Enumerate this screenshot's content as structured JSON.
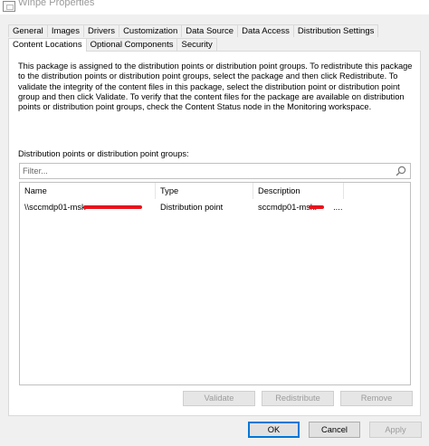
{
  "window": {
    "title": "Winpe Properties"
  },
  "tabs_row1": [
    "General",
    "Images",
    "Drivers",
    "Customization",
    "Data Source",
    "Data Access",
    "Distribution Settings"
  ],
  "tabs_row2": [
    "Content Locations",
    "Optional Components",
    "Security"
  ],
  "active_tab": "Content Locations",
  "description": "This package is assigned to the distribution points or distribution point groups. To redistribute this package to the distribution points or distribution point groups, select the package and then click Redistribute. To validate the integrity of the content files in this package, select the distribution point or distribution point group and then click Validate. To verify that the content files for the package are available on distribution points or distribution point groups, check the Content Status node in the Monitoring workspace.",
  "list": {
    "label": "Distribution points or distribution point groups:",
    "filter_placeholder": "Filter...",
    "columns": [
      "Name",
      "Type",
      "Description"
    ],
    "rows": [
      {
        "name": "\\\\sccmdp01-msk",
        "type": "Distribution point",
        "description": "sccmdp01-msk.",
        "description_suffix": "...."
      }
    ]
  },
  "actions": {
    "validate": "Validate",
    "redistribute": "Redistribute",
    "remove": "Remove"
  },
  "footer": {
    "ok": "OK",
    "cancel": "Cancel",
    "apply": "Apply"
  },
  "colors": {
    "accent": "#0078d7",
    "redaction": "#e8141c"
  },
  "icons": {
    "search": "search-icon",
    "window": "window-icon"
  }
}
